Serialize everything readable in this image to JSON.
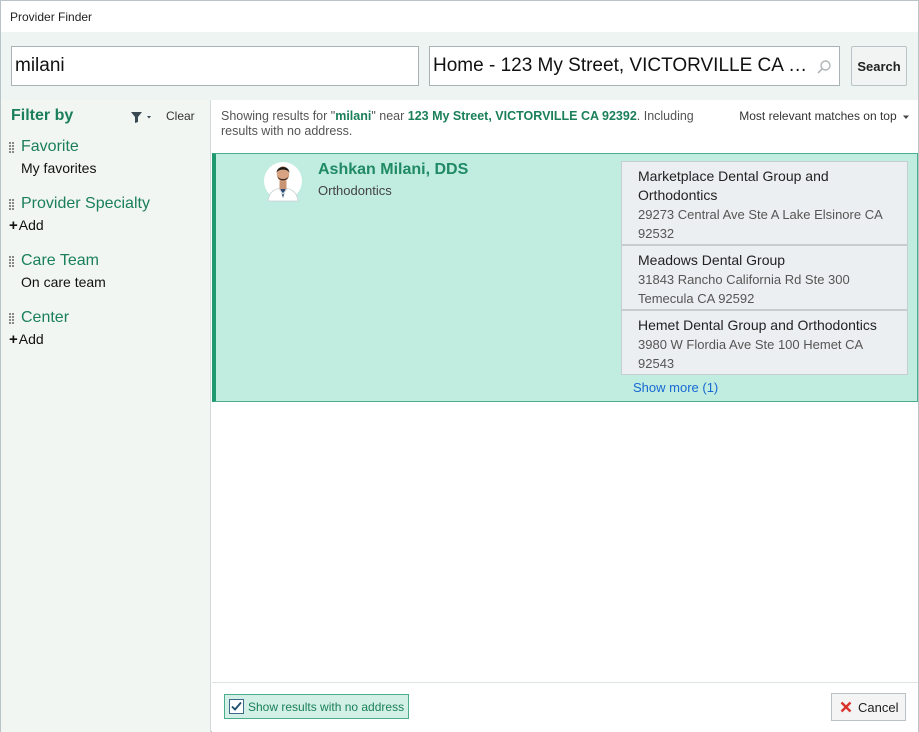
{
  "window": {
    "title": "Provider Finder"
  },
  "search": {
    "name_value": "milani",
    "location_value": "Home - 123 My Street, VICTORVILLE CA 92392",
    "button_label": "Search",
    "button_accel": "h"
  },
  "filter": {
    "title": "Filter by",
    "clear_label": "Clear",
    "groups": [
      {
        "title": "Favorite",
        "value": "My favorites"
      },
      {
        "title": "Provider Specialty",
        "add_label": "Add"
      },
      {
        "title": "Care Team",
        "value": "On care team"
      },
      {
        "title": "Center",
        "add_label": "Add"
      }
    ]
  },
  "results": {
    "summary_prefix": "Showing results for \"",
    "query": "milani",
    "summary_mid": "\" near ",
    "location": "123 My Street, VICTORVILLE CA 92392",
    "summary_suffix": ". Including results with no address.",
    "sort_label": "Most relevant matches on top",
    "providers": [
      {
        "name": "Ashkan Milani, DDS",
        "specialty": "Orthodontics",
        "locations": [
          {
            "name": "Marketplace Dental Group and Orthodontics",
            "address": "29273 Central Ave Ste A Lake Elsinore CA 92532"
          },
          {
            "name": "Meadows Dental Group",
            "address": "31843 Rancho California Rd Ste 300 Temecula CA 92592"
          },
          {
            "name": "Hemet Dental Group and Orthodontics",
            "address": "3980 W Flordia Ave Ste 100 Hemet CA 92543"
          }
        ],
        "show_more": "Show more (1)"
      }
    ]
  },
  "footer": {
    "no_address_label": "Show results with no address",
    "no_address_checked": true,
    "cancel_label": "Cancel"
  },
  "colors": {
    "accent_green": "#1a7f5a",
    "selected_card": "#c1ece0",
    "link_blue": "#1769d4",
    "cancel_red": "#d9342b"
  }
}
